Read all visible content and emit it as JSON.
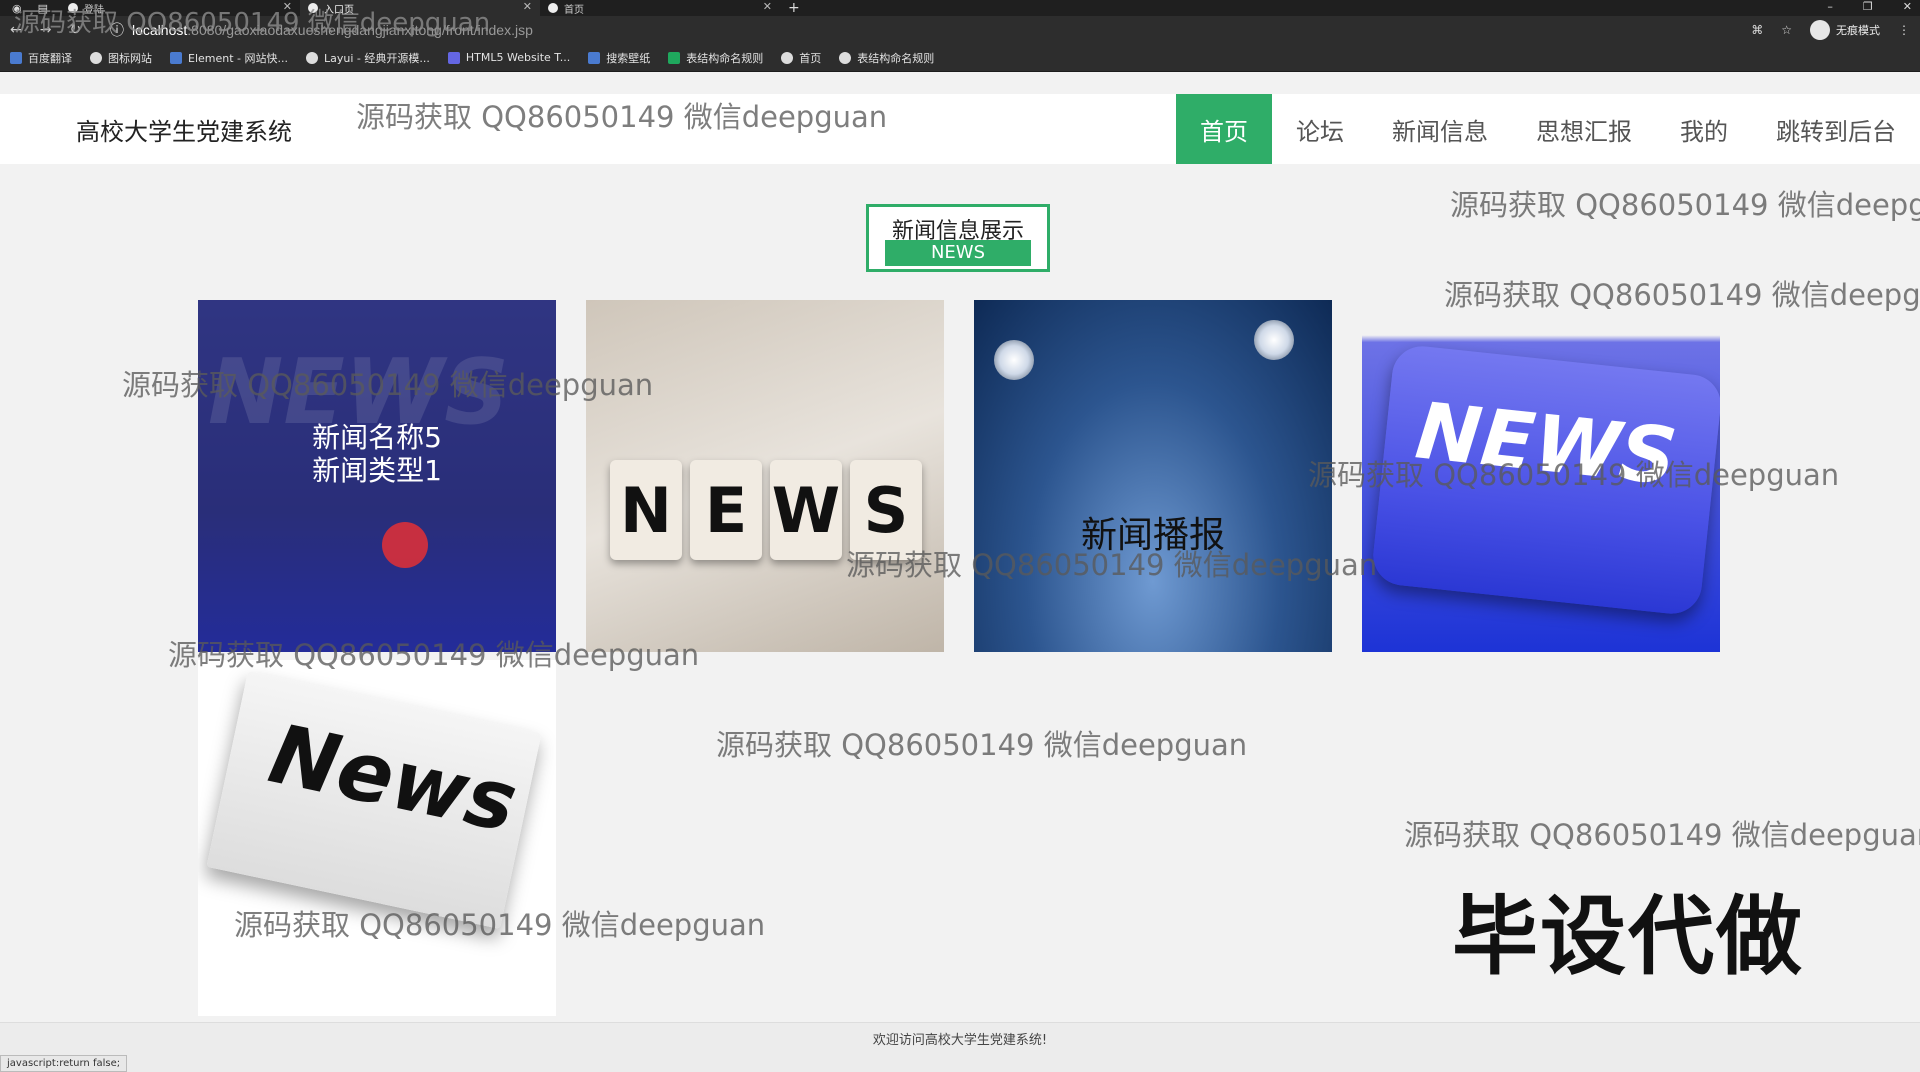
{
  "browser": {
    "tabs": [
      {
        "label": "登陆",
        "active": false
      },
      {
        "label": "入口页",
        "active": true
      },
      {
        "label": "首页",
        "active": false
      }
    ],
    "url_host": "localhost",
    "url_path": ":8080/gaoxiaodaxueshengdangjianxitong/front/index.jsp",
    "incognito_label": "无痕模式",
    "bookmarks": [
      "百度翻译",
      "图标网站",
      "Element - 网站快...",
      "Layui - 经典开源模...",
      "HTML5 Website T...",
      "搜索壁纸",
      "表结构命名规则",
      "首页",
      "表结构命名规则"
    ]
  },
  "site": {
    "title": "高校大学生党建系统",
    "nav": [
      "首页",
      "论坛",
      "新闻信息",
      "思想汇报",
      "我的",
      "跳转到后台"
    ],
    "active_nav": "首页",
    "accent_color": "#2fad68"
  },
  "section": {
    "title": "新闻信息展示",
    "subtitle": "NEWS"
  },
  "cards": [
    {
      "line1": "新闻名称5",
      "line2": "新闻类型1",
      "image": "news-keyboard-dark"
    },
    {
      "line1": "",
      "line2": "",
      "image": "news-blocks",
      "blocks": [
        "N",
        "E",
        "W",
        "S"
      ]
    },
    {
      "line1": "新闻播报",
      "line2": "",
      "image": "spotlights"
    },
    {
      "line1": "",
      "line2": "",
      "image": "news-keyboard-blue",
      "key_text": "NEWS"
    },
    {
      "line1": "",
      "line2": "",
      "image": "newspaper",
      "paper_text": "News"
    }
  ],
  "watermark_text": "源码获取 QQ86050149 微信deepguan",
  "stamp_text": "毕设代做",
  "footer_text": "欢迎访问高校大学生党建系统!",
  "status_text": "javascript:return false;"
}
